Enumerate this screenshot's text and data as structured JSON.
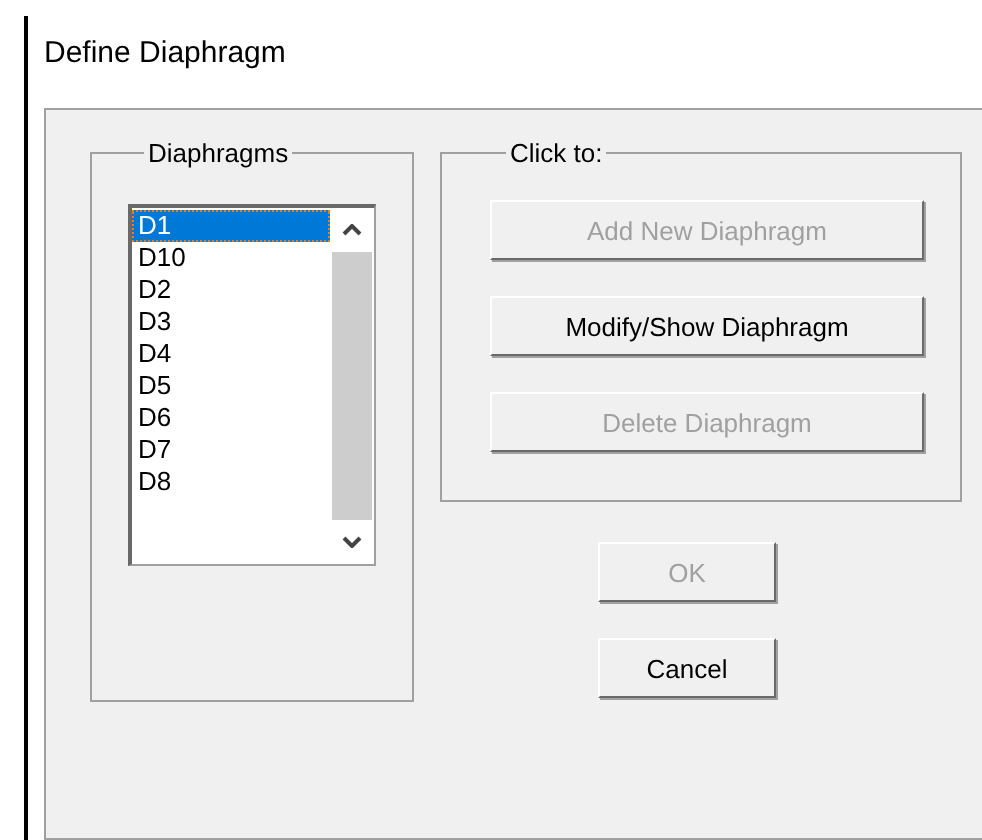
{
  "window": {
    "title": "Define Diaphragm"
  },
  "diaphragms": {
    "label": "Diaphragms",
    "items": [
      {
        "label": "D1",
        "selected": true
      },
      {
        "label": "D10",
        "selected": false
      },
      {
        "label": "D2",
        "selected": false
      },
      {
        "label": "D3",
        "selected": false
      },
      {
        "label": "D4",
        "selected": false
      },
      {
        "label": "D5",
        "selected": false
      },
      {
        "label": "D6",
        "selected": false
      },
      {
        "label": "D7",
        "selected": false
      },
      {
        "label": "D8",
        "selected": false
      }
    ]
  },
  "actions": {
    "label": "Click to:",
    "buttons": [
      {
        "label": "Add New Diaphragm",
        "disabled": true
      },
      {
        "label": "Modify/Show Diaphragm",
        "disabled": false
      },
      {
        "label": "Delete Diaphragm",
        "disabled": true
      }
    ]
  },
  "buttons": [
    {
      "label": "OK",
      "disabled": true
    },
    {
      "label": "Cancel",
      "disabled": false
    }
  ]
}
